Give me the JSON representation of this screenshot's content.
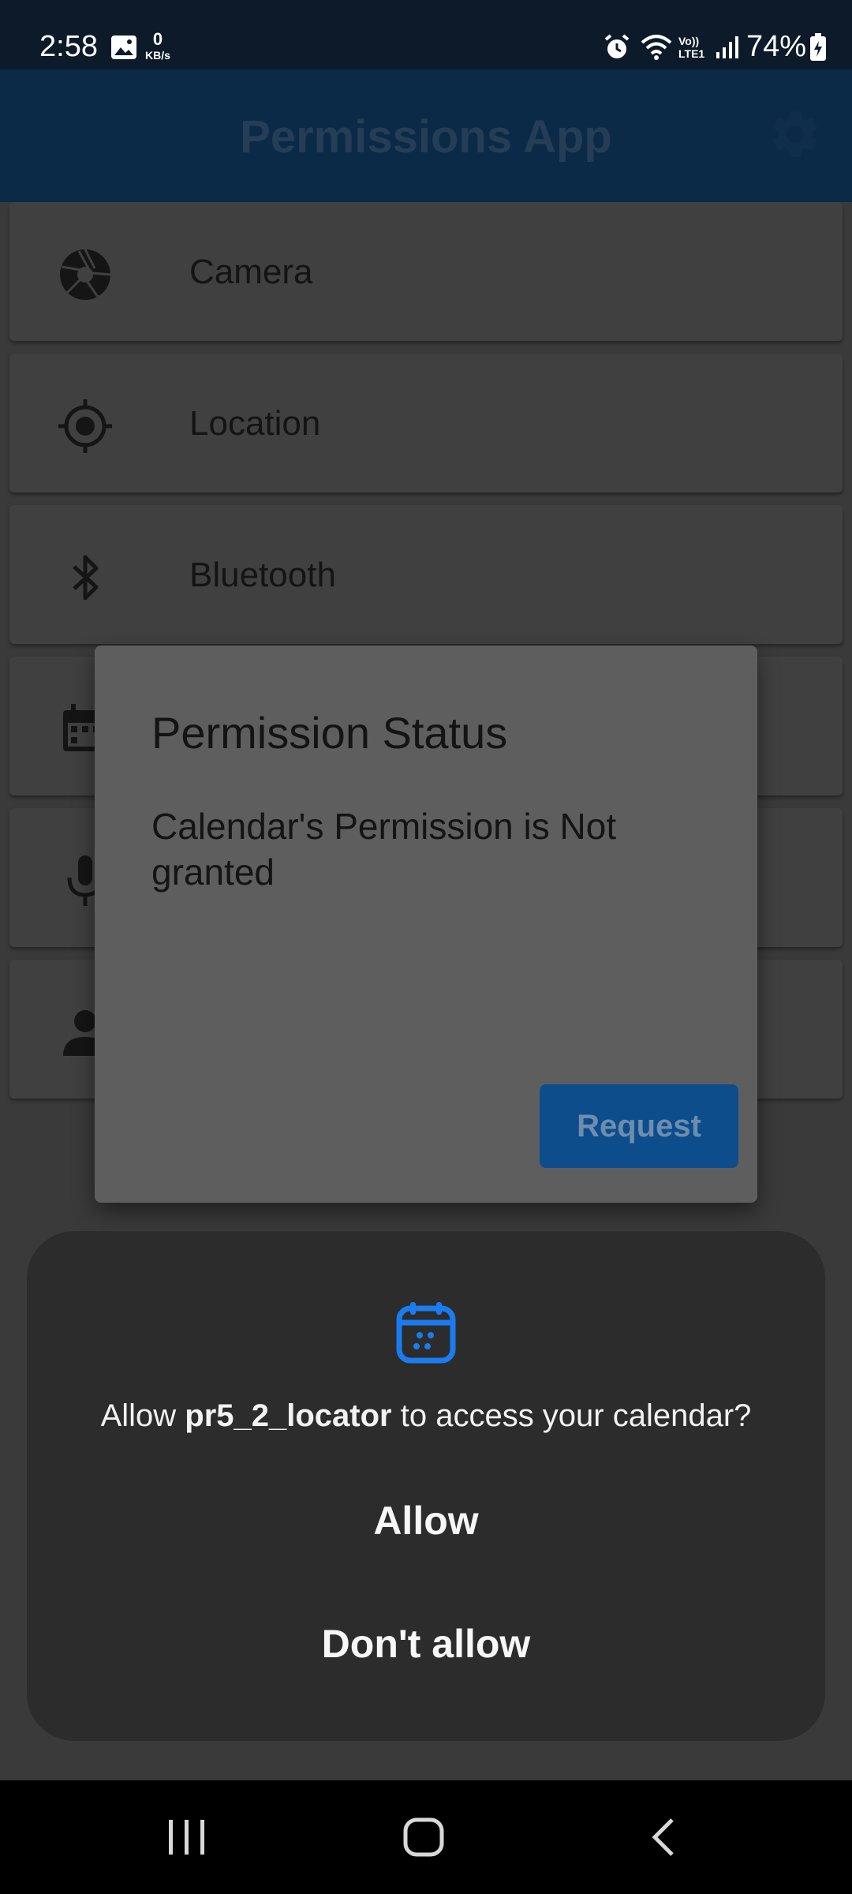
{
  "status_bar": {
    "time": "2:58",
    "data_rate_value": "0",
    "data_rate_unit": "KB/s",
    "network_label_top": "Vo))",
    "network_label_bottom": "LTE1",
    "battery": "74%"
  },
  "app_bar": {
    "title": "Permissions App",
    "settings_icon": "gear-icon"
  },
  "permissions": [
    {
      "label": "Camera",
      "icon": "camera-aperture-icon"
    },
    {
      "label": "Location",
      "icon": "location-crosshair-icon"
    },
    {
      "label": "Bluetooth",
      "icon": "bluetooth-icon"
    },
    {
      "label": "",
      "icon": "calendar-icon"
    },
    {
      "label": "",
      "icon": "microphone-icon"
    },
    {
      "label": "",
      "icon": "person-icon"
    }
  ],
  "dialog": {
    "title": "Permission Status",
    "message": "Calendar's Permission is Not granted",
    "request_button": "Request"
  },
  "system_prompt": {
    "icon": "calendar-icon",
    "question_prefix": "Allow ",
    "app_name": "pr5_2_locator",
    "question_suffix": " to access your calendar?",
    "allow": "Allow",
    "deny": "Don't allow"
  },
  "nav": {
    "recents": "recents-icon",
    "home": "home-icon",
    "back": "back-icon"
  },
  "colors": {
    "app_bar": "#0b2a48",
    "request_button": "#0e4d8c",
    "prompt_accent": "#1a7cf0"
  }
}
